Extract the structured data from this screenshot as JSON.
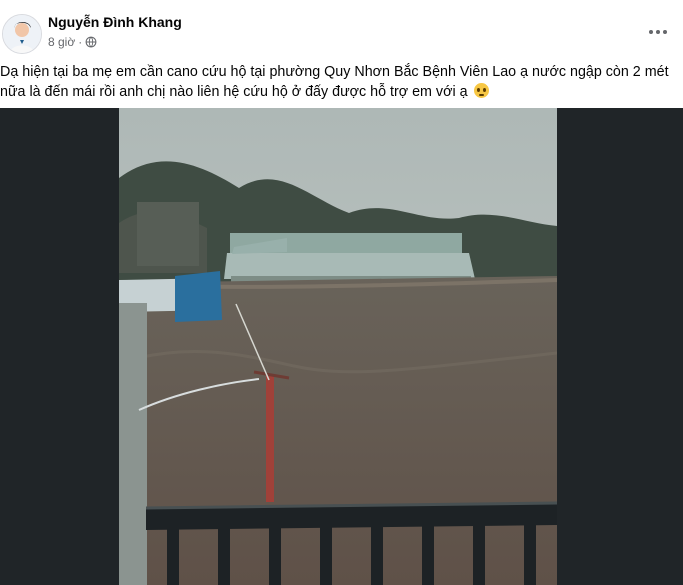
{
  "post": {
    "author": "Nguyễn Đình Khang",
    "time": "8 giờ",
    "separator": "·",
    "privacy_icon": "globe-icon",
    "more_icon": "more-options-icon",
    "caption": "Dạ hiện tại ba mẹ em cần cano cứu hộ tại phường Quy Nhơn Bắc Bệnh Viên Lao ạ nước ngập còn 2 mét nữa là đến mái rồi anh chị nào liên hệ cứu hộ ở đấy được hỗ trợ em với ạ",
    "caption_emoji": "pleading-face-emoji"
  },
  "colors": {
    "text_primary": "#050505",
    "text_secondary": "#65676b",
    "media_background": "#202528",
    "flood_water": "#6f6256",
    "sky": "#b8c2c0"
  }
}
